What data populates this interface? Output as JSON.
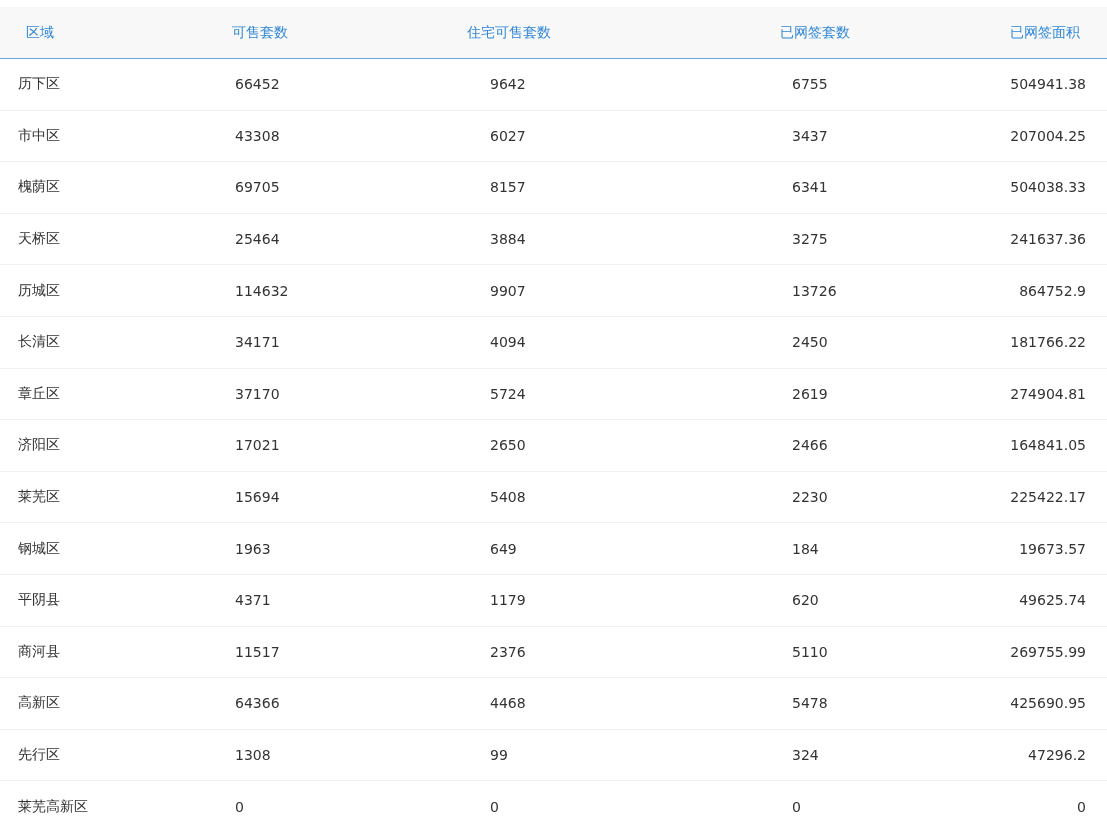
{
  "table": {
    "columns": [
      "区域",
      "可售套数",
      "住宅可售套数",
      "已网签套数",
      "已网签面积"
    ],
    "rows": [
      [
        "历下区",
        "66452",
        "9642",
        "6755",
        "504941.38"
      ],
      [
        "市中区",
        "43308",
        "6027",
        "3437",
        "207004.25"
      ],
      [
        "槐荫区",
        "69705",
        "8157",
        "6341",
        "504038.33"
      ],
      [
        "天桥区",
        "25464",
        "3884",
        "3275",
        "241637.36"
      ],
      [
        "历城区",
        "114632",
        "9907",
        "13726",
        "864752.9"
      ],
      [
        "长清区",
        "34171",
        "4094",
        "2450",
        "181766.22"
      ],
      [
        "章丘区",
        "37170",
        "5724",
        "2619",
        "274904.81"
      ],
      [
        "济阳区",
        "17021",
        "2650",
        "2466",
        "164841.05"
      ],
      [
        "莱芜区",
        "15694",
        "5408",
        "2230",
        "225422.17"
      ],
      [
        "钢城区",
        "1963",
        "649",
        "184",
        "19673.57"
      ],
      [
        "平阴县",
        "4371",
        "1179",
        "620",
        "49625.74"
      ],
      [
        "商河县",
        "11517",
        "2376",
        "5110",
        "269755.99"
      ],
      [
        "高新区",
        "64366",
        "4468",
        "5478",
        "425690.95"
      ],
      [
        "先行区",
        "1308",
        "99",
        "324",
        "47296.2"
      ],
      [
        "莱芜高新区",
        "0",
        "0",
        "0",
        "0"
      ]
    ]
  }
}
